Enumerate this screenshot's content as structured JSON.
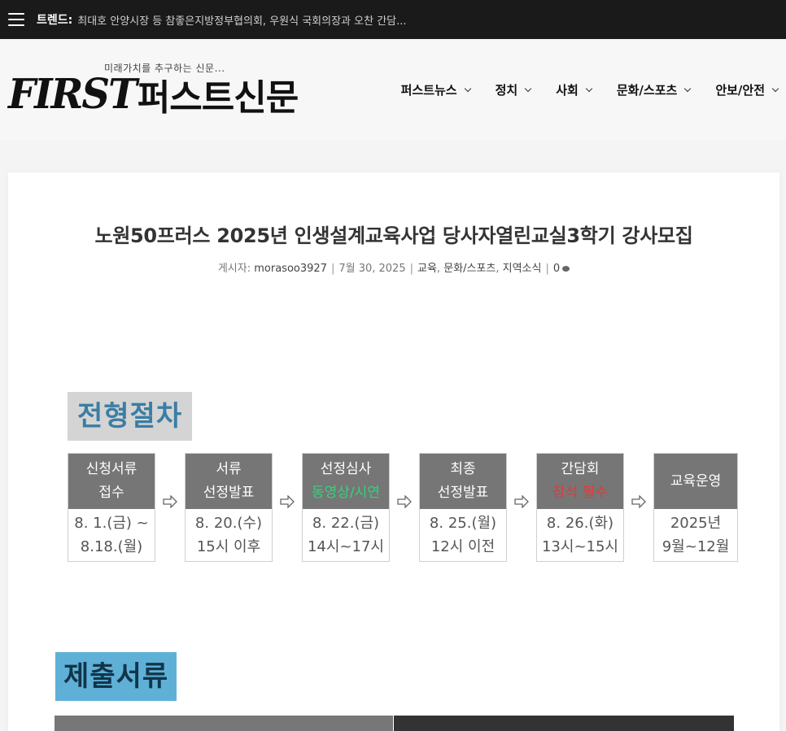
{
  "topbar": {
    "trend_label": "트렌드:",
    "trend_text": "최대호 안양시장 등 참좋은지방정부협의회, 우원식 국회의장과 오찬 간담..."
  },
  "header": {
    "tagline": "미래가치를 추구하는 신문...",
    "logo_latin": "FIRST",
    "logo_korean": "퍼스트신문",
    "nav": [
      {
        "label": "퍼스트뉴스"
      },
      {
        "label": "정치"
      },
      {
        "label": "사회"
      },
      {
        "label": "문화/스포츠"
      },
      {
        "label": "안보/안전"
      }
    ]
  },
  "article": {
    "title": "노원50프러스 2025년 인생설계교육사업 당사자열린교실3학기 강사모집",
    "meta": {
      "by_label": "게시자:",
      "author": "morasoo3927",
      "date": "7월 30, 2025",
      "categories": [
        "교육",
        "문화/스포츠",
        "지역소식"
      ],
      "comments": "0"
    },
    "section1_title": "전형절차",
    "steps": [
      {
        "head1": "신청서류",
        "head2": "접수",
        "body1": "8. 1.(금) ~",
        "body2": "8.18.(월)"
      },
      {
        "head1": "서류",
        "head2": "선정발표",
        "body1": "8. 20.(수)",
        "body2": "15시 이후"
      },
      {
        "head1": "선정심사",
        "head2": "동영상/시연",
        "body1": "8. 22.(금)",
        "body2": "14시~17시"
      },
      {
        "head1": "최종",
        "head2": "선정발표",
        "body1": "8. 25.(월)",
        "body2": "12시 이전"
      },
      {
        "head1": "간담회",
        "head2": "참석 필수",
        "body1": "8. 26.(화)",
        "body2": "13시~15시"
      },
      {
        "head1": "교육운영",
        "head2": "",
        "body1": "2025년",
        "body2": "9월~12월"
      }
    ],
    "section2_title": "제출서류"
  },
  "colors": {
    "topbar_bg": "#1a1a1a",
    "step_head": "#767676",
    "section1_bg": "#d4d4d4",
    "section1_text": "#3a7ea4",
    "section2_bg": "#5fb0d7",
    "highlight_green": "#35d27c",
    "highlight_red": "#e23a3a"
  }
}
